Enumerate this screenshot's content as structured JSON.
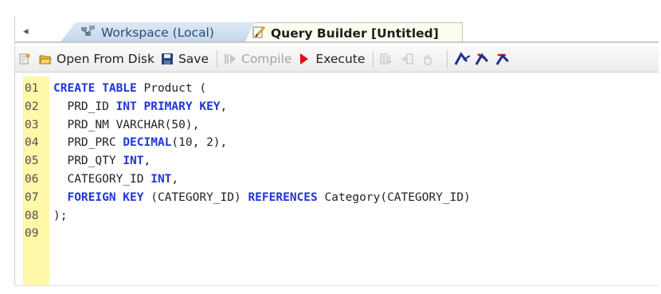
{
  "tabs": {
    "scroll_arrow": "◂",
    "workspace": {
      "label": "Workspace (Local)",
      "icon": "workspace-icon"
    },
    "query_builder": {
      "label": "Query Builder [Untitled]",
      "icon": "query-builder-icon",
      "active": true
    }
  },
  "toolbar": {
    "open_label": "Open From Disk",
    "save_label": "Save",
    "compile_label": "Compile",
    "execute_label": "Execute"
  },
  "editor": {
    "lines": [
      {
        "no": "01",
        "tokens": [
          {
            "t": "CREATE TABLE",
            "kw": true
          },
          {
            "t": " Product ("
          }
        ]
      },
      {
        "no": "02",
        "tokens": [
          {
            "t": "  PRD_ID "
          },
          {
            "t": "INT PRIMARY KEY",
            "kw": true
          },
          {
            "t": ","
          }
        ]
      },
      {
        "no": "03",
        "tokens": [
          {
            "t": "  PRD_NM VARCHAR(50),"
          }
        ]
      },
      {
        "no": "04",
        "tokens": [
          {
            "t": "  PRD_PRC "
          },
          {
            "t": "DECIMAL",
            "kw": true
          },
          {
            "t": "(10, 2),"
          }
        ]
      },
      {
        "no": "05",
        "tokens": [
          {
            "t": "  PRD_QTY "
          },
          {
            "t": "INT",
            "kw": true
          },
          {
            "t": ","
          }
        ]
      },
      {
        "no": "06",
        "tokens": [
          {
            "t": "  CATEGORY_ID "
          },
          {
            "t": "INT",
            "kw": true
          },
          {
            "t": ","
          }
        ]
      },
      {
        "no": "07",
        "tokens": [
          {
            "t": "  "
          },
          {
            "t": "FOREIGN KEY",
            "kw": true
          },
          {
            "t": " (CATEGORY_ID) "
          },
          {
            "t": "REFERENCES",
            "kw": true
          },
          {
            "t": " Category(CATEGORY_ID)"
          }
        ]
      },
      {
        "no": "08",
        "tokens": [
          {
            "t": ");"
          }
        ]
      },
      {
        "no": "09",
        "tokens": []
      }
    ]
  },
  "colors": {
    "keyword": "#1f36d6",
    "gutter": "#fff8a8",
    "execute_red": "#e01010"
  }
}
